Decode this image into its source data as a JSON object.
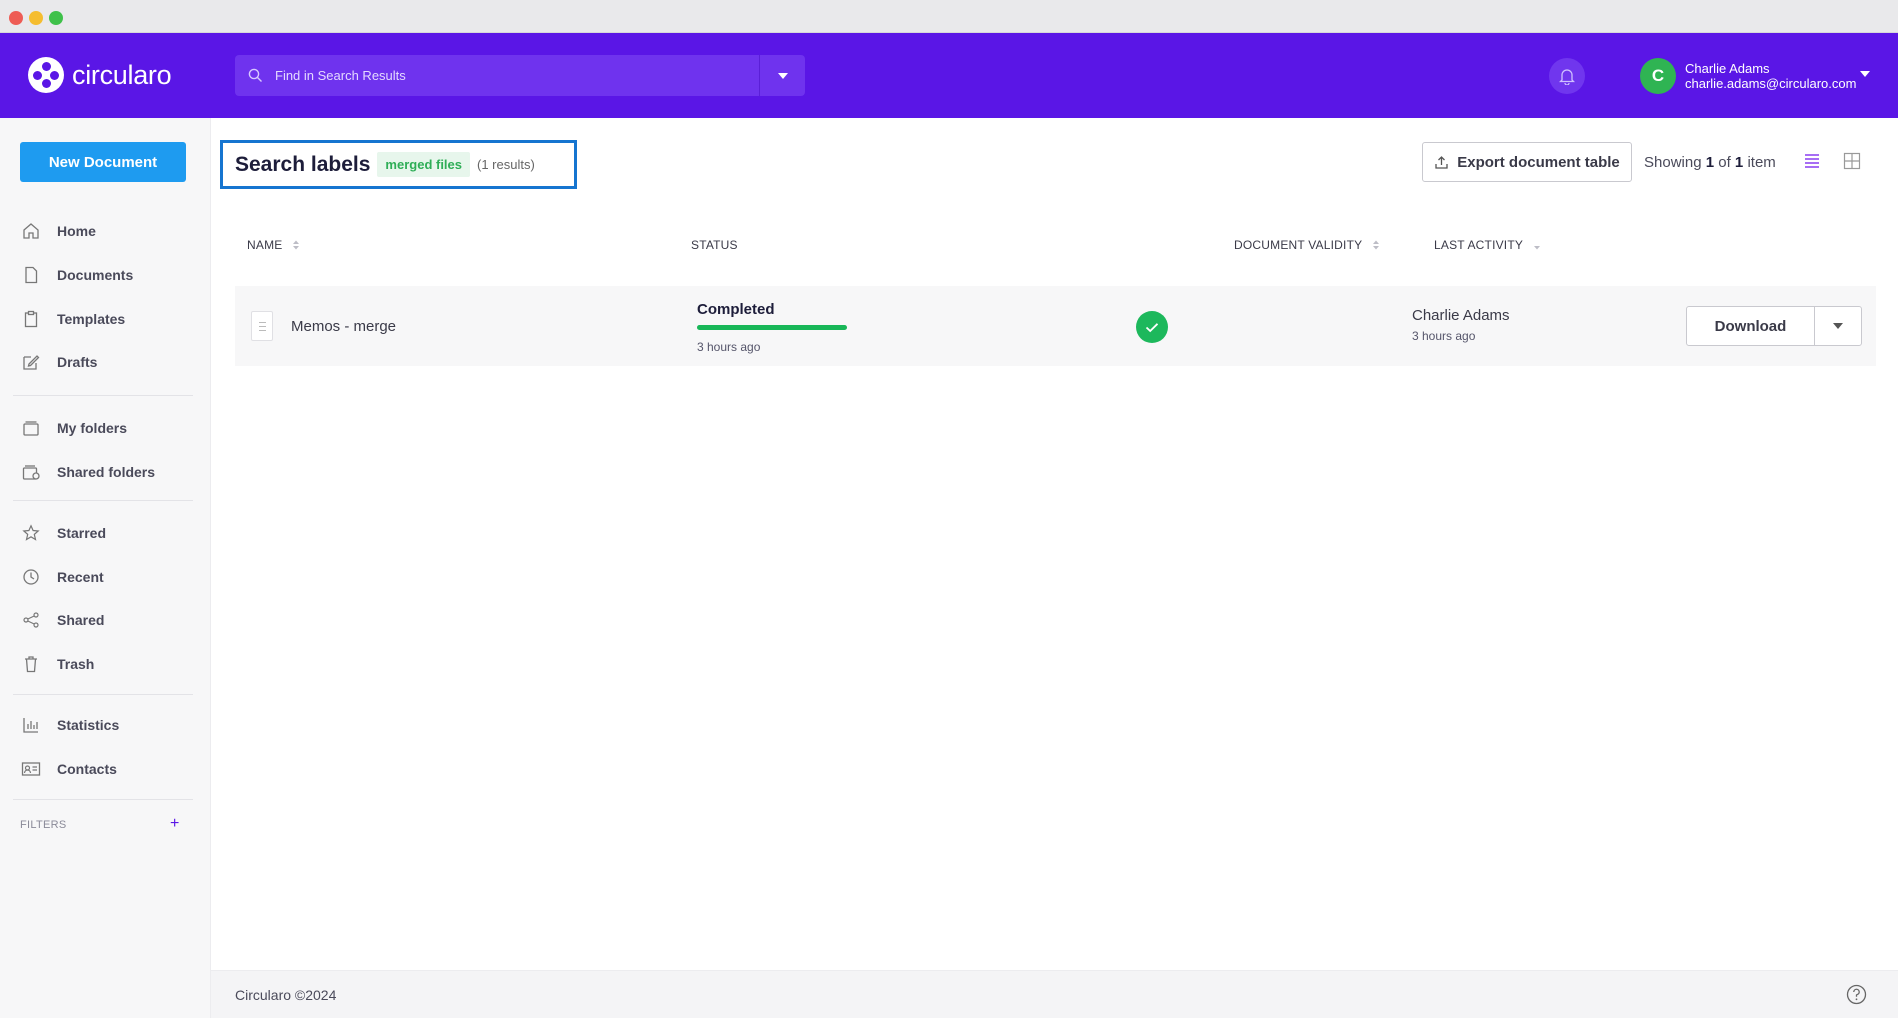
{
  "window": {
    "controls": [
      "close",
      "minimize",
      "maximize"
    ]
  },
  "brand": {
    "name": "circularo",
    "color": "#5a16e6"
  },
  "search": {
    "placeholder": "Find in Search Results"
  },
  "user": {
    "initial": "C",
    "name": "Charlie Adams",
    "email": "charlie.adams@circularo.com"
  },
  "sidebar": {
    "new_document": "New Document",
    "items": [
      {
        "label": "Home",
        "icon": "home-icon"
      },
      {
        "label": "Documents",
        "icon": "document-icon"
      },
      {
        "label": "Templates",
        "icon": "template-icon"
      },
      {
        "label": "Drafts",
        "icon": "pencil-icon"
      },
      {
        "label": "My folders",
        "icon": "folder-icon"
      },
      {
        "label": "Shared folders",
        "icon": "shared-folder-icon"
      },
      {
        "label": "Starred",
        "icon": "star-icon"
      },
      {
        "label": "Recent",
        "icon": "clock-icon"
      },
      {
        "label": "Shared",
        "icon": "share-icon"
      },
      {
        "label": "Trash",
        "icon": "trash-icon"
      },
      {
        "label": "Statistics",
        "icon": "chart-icon"
      },
      {
        "label": "Contacts",
        "icon": "contact-card-icon"
      }
    ],
    "filters_label": "FILTERS",
    "filters_add": "+"
  },
  "main": {
    "heading": "Search labels",
    "tag": "merged files",
    "results": "(1 results)",
    "export_label": "Export document table",
    "showing": {
      "prefix": "Showing",
      "from": "1",
      "of": "of",
      "total": "1",
      "suffix": "item"
    },
    "columns": [
      "NAME",
      "STATUS",
      "DOCUMENT VALIDITY",
      "LAST ACTIVITY"
    ],
    "rows": [
      {
        "name": "Memos - merge",
        "status": "Completed",
        "progress": 1.0,
        "status_time": "3 hours ago",
        "activity_user": "Charlie Adams",
        "activity_time": "3 hours ago",
        "action": "Download"
      }
    ]
  },
  "footer": {
    "text": "Circularo ©2024"
  },
  "colors": {
    "accent": "#5a16e6",
    "button_blue": "#1e9bf0",
    "success": "#1db85c",
    "highlight_border": "#1675d0"
  }
}
